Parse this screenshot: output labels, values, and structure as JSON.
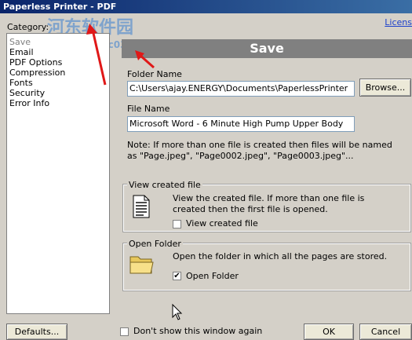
{
  "window": {
    "title": "Paperless Printer - PDF",
    "license_link": "Licens"
  },
  "watermark": {
    "line1": "河东软件园",
    "line2": "www.pc0359.cn"
  },
  "sidebar": {
    "category_label": "Category:",
    "items": [
      "Save",
      "Email",
      "PDF Options",
      "Compression",
      "Fonts",
      "Security",
      "Error Info"
    ],
    "selected_index": 0
  },
  "main": {
    "header": "Save",
    "folder_name_label": "Folder Name",
    "folder_value": "C:\\Users\\ajay.ENERGY\\Documents\\PaperlessPrinter",
    "browse_label": "Browse...",
    "file_name_label": "File Name",
    "file_value": "Microsoft Word - 6 Minute High Pump Upper Body",
    "note_line1": "Note: If more than one file is created then files will be named",
    "note_line2": "as \"Page.jpeg\", \"Page0002.jpeg\", \"Page0003.jpeg\"...",
    "view_group": {
      "title": "View created file",
      "desc_line1": "View the created file. If more than one file is",
      "desc_line2": "created then the first file is opened.",
      "checkbox_label": "View created file",
      "checked": false
    },
    "folder_group": {
      "title": "Open Folder",
      "desc": "Open the folder in which all the pages are stored.",
      "checkbox_label": "Open Folder",
      "checked": true,
      "check_glyph": "✔"
    }
  },
  "footer": {
    "defaults_label": "Defaults...",
    "dont_show_label": "Don't show this window again",
    "dont_show_checked": false,
    "ok_label": "OK",
    "cancel_label": "Cancel"
  },
  "colors": {
    "title_bar": "#0a246a",
    "header_bar": "#808080",
    "face": "#d4d0c8",
    "annotation_arrow": "#e01818"
  }
}
